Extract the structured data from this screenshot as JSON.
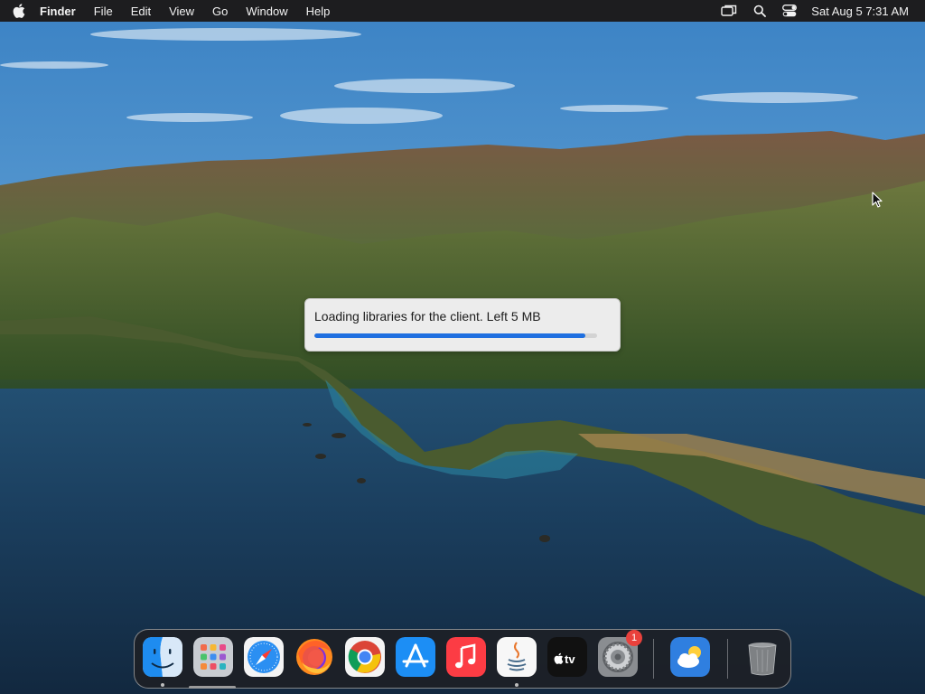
{
  "menubar": {
    "app_name": "Finder",
    "menus": [
      "File",
      "Edit",
      "View",
      "Go",
      "Window",
      "Help"
    ],
    "clock": "Sat Aug 5  7:31 AM",
    "status_icons": [
      "screen-mirroring-icon",
      "spotlight-search-icon",
      "control-center-icon"
    ]
  },
  "dialog": {
    "message": "Loading libraries for the client. Left 5 MB",
    "progress": 0.96,
    "accent": "#1f6fe0"
  },
  "dock": {
    "apps": [
      {
        "name": "Finder",
        "icon": "finder-icon",
        "running": true
      },
      {
        "name": "Launchpad",
        "icon": "launchpad-icon",
        "running": false
      },
      {
        "name": "Safari",
        "icon": "safari-icon",
        "running": false
      },
      {
        "name": "Firefox",
        "icon": "firefox-icon",
        "running": false
      },
      {
        "name": "Google Chrome",
        "icon": "chrome-icon",
        "running": false
      },
      {
        "name": "App Store",
        "icon": "app-store-icon",
        "running": false
      },
      {
        "name": "Music",
        "icon": "music-icon",
        "running": false
      },
      {
        "name": "Java",
        "icon": "java-icon",
        "running": true
      },
      {
        "name": "Apple TV",
        "icon": "apple-tv-icon",
        "running": false
      },
      {
        "name": "System Preferences",
        "icon": "system-preferences-icon",
        "running": false,
        "badge": "1"
      },
      {
        "name": "Weather",
        "icon": "weather-icon",
        "running": false
      },
      {
        "name": "Trash",
        "icon": "trash-icon",
        "running": false
      }
    ]
  }
}
